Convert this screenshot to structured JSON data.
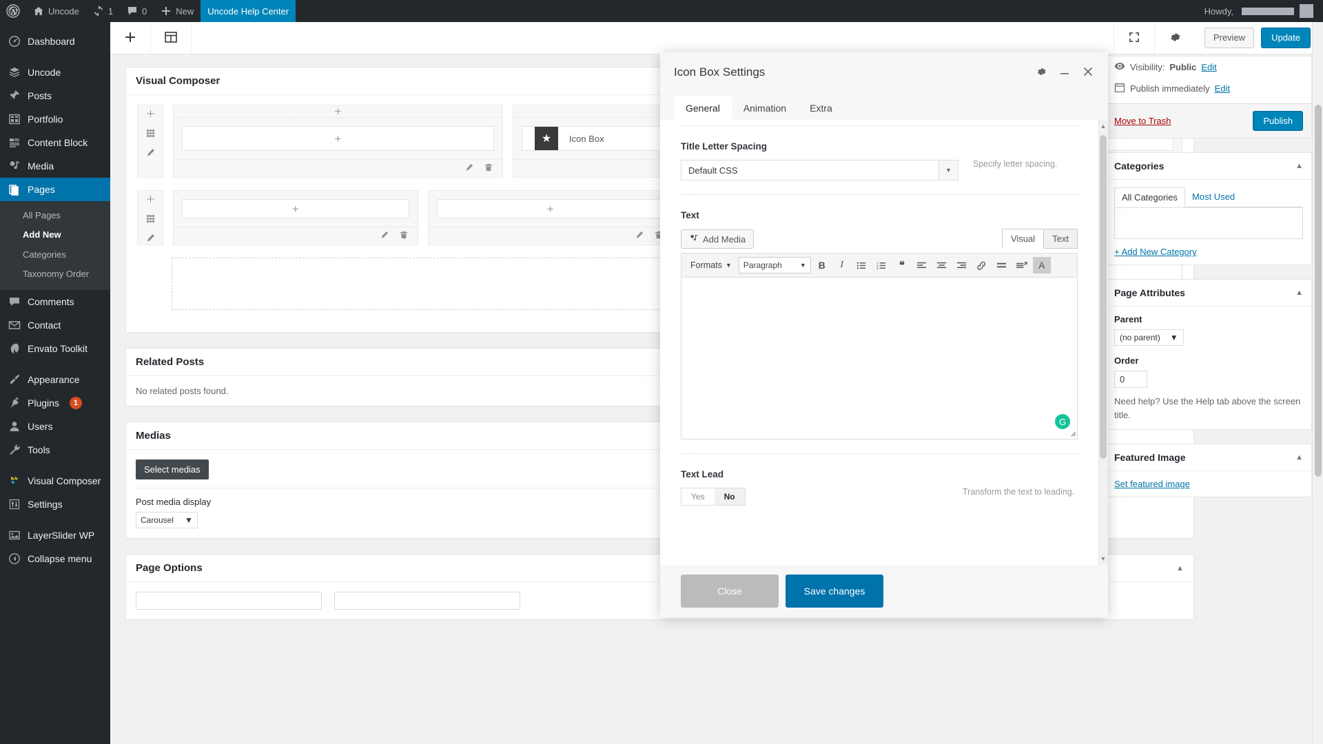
{
  "adminbar": {
    "site_name": "Uncode",
    "updates_count": "1",
    "comments_count": "0",
    "new_label": "New",
    "active_page": "Uncode Help Center",
    "howdy": "Howdy,"
  },
  "sidebar": {
    "items": [
      {
        "label": "Dashboard",
        "icon": "dashboard-icon"
      },
      {
        "label": "Uncode",
        "icon": "layers-icon"
      },
      {
        "label": "Posts",
        "icon": "pin-icon"
      },
      {
        "label": "Portfolio",
        "icon": "portfolio-icon"
      },
      {
        "label": "Content Block",
        "icon": "content-block-icon"
      },
      {
        "label": "Media",
        "icon": "media-icon"
      },
      {
        "label": "Pages",
        "icon": "pages-icon",
        "current": true
      },
      {
        "label": "Comments",
        "icon": "comments-icon"
      },
      {
        "label": "Contact",
        "icon": "envelope-icon"
      },
      {
        "label": "Envato Toolkit",
        "icon": "envato-icon"
      },
      {
        "label": "Appearance",
        "icon": "brush-icon"
      },
      {
        "label": "Plugins",
        "icon": "plug-icon",
        "badge": "1"
      },
      {
        "label": "Users",
        "icon": "user-icon"
      },
      {
        "label": "Tools",
        "icon": "wrench-icon"
      },
      {
        "label": "Visual Composer",
        "icon": "vc-icon"
      },
      {
        "label": "Settings",
        "icon": "settings-sliders-icon"
      },
      {
        "label": "LayerSlider WP",
        "icon": "layerslider-icon"
      },
      {
        "label": "Collapse menu",
        "icon": "collapse-icon"
      }
    ],
    "submenu": [
      {
        "label": "All Pages",
        "active": false
      },
      {
        "label": "Add New",
        "active": true
      },
      {
        "label": "Categories",
        "active": false
      },
      {
        "label": "Taxonomy Order",
        "active": false
      }
    ]
  },
  "vcbar": {
    "add_element_icon": "plus-icon",
    "templates_icon": "templates-icon",
    "fullscreen_icon": "fullscreen-icon",
    "settings_icon": "gear-icon",
    "preview_label": "Preview",
    "update_label": "Update"
  },
  "content": {
    "vc_panel_title": "Visual Composer",
    "icon_box_label": "Icon Box",
    "related_posts": {
      "title": "Related Posts",
      "empty_text": "No related posts found."
    },
    "medias": {
      "title": "Medias",
      "select_button": "Select medias",
      "display_label": "Post media display",
      "display_value": "Carousel"
    },
    "page_options": {
      "title": "Page Options"
    }
  },
  "publish_panel": {
    "visibility_label": "Visibility:",
    "visibility_value": "Public",
    "visibility_edit": "Edit",
    "schedule_label": "Publish immediately",
    "schedule_edit": "Edit",
    "trash_label": "Move to Trash",
    "publish_label": "Publish"
  },
  "categories_panel": {
    "title": "Categories",
    "tab_all": "All Categories",
    "tab_most_used": "Most Used",
    "add_new": "+ Add New Category"
  },
  "page_attributes_panel": {
    "title": "Page Attributes",
    "parent_label": "Parent",
    "parent_value": "(no parent)",
    "order_label": "Order",
    "order_value": "0",
    "help_text": "Need help? Use the Help tab above the screen title."
  },
  "featured_image_panel": {
    "title": "Featured Image",
    "set_link": "Set featured image"
  },
  "modal": {
    "title": "Icon Box Settings",
    "tabs": [
      {
        "label": "General",
        "active": true
      },
      {
        "label": "Animation",
        "active": false
      },
      {
        "label": "Extra",
        "active": false
      }
    ],
    "header_icons": {
      "settings": "gear-icon",
      "minimize": "minimize-icon",
      "close": "close-icon"
    },
    "fields": {
      "title_letter_spacing": {
        "label": "Title Letter Spacing",
        "value": "Default CSS",
        "description": "Specify letter spacing."
      },
      "text": {
        "label": "Text",
        "add_media": "Add Media",
        "tab_visual": "Visual",
        "tab_text": "Text",
        "formats_label": "Formats",
        "paragraph_label": "Paragraph",
        "content": ""
      },
      "text_lead": {
        "label": "Text Lead",
        "option_yes": "Yes",
        "option_no": "No",
        "selected": "No",
        "description": "Transform the text to leading."
      }
    },
    "footer": {
      "close_label": "Close",
      "save_label": "Save changes"
    }
  },
  "colors": {
    "admin_bar": "#23282d",
    "accent_blue": "#0073aa",
    "publish_blue": "#0085ba",
    "badge_orange": "#d54e21",
    "trash_red": "#a00000",
    "grammarly_green": "#15c39a"
  }
}
